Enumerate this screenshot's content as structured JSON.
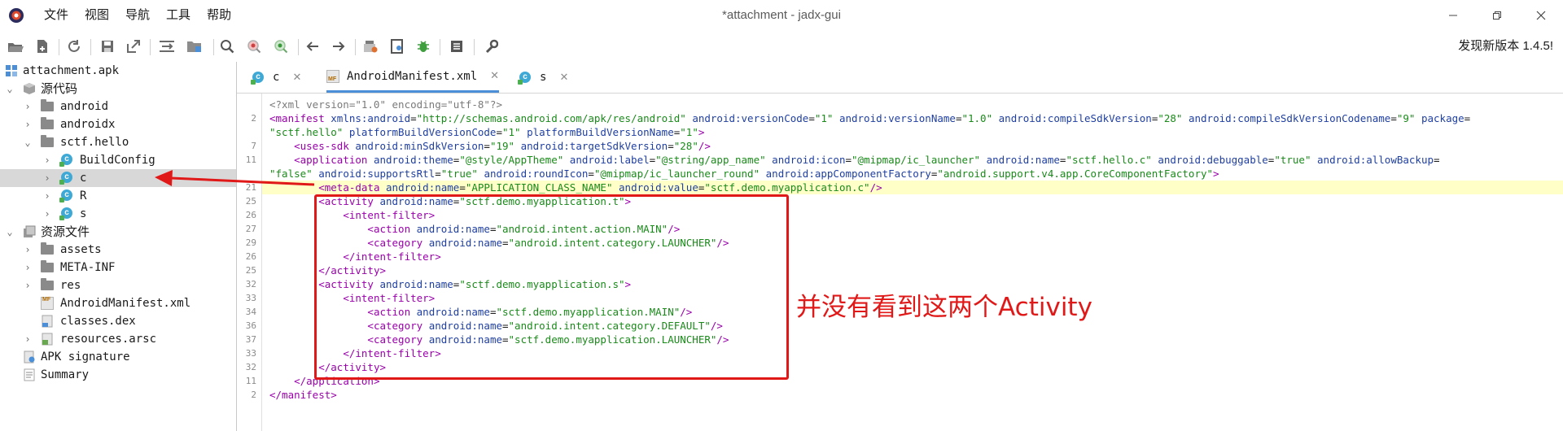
{
  "window": {
    "title": "*attachment - jadx-gui",
    "menu": [
      "文件",
      "视图",
      "导航",
      "工具",
      "帮助"
    ],
    "update_notice": "发现新版本 1.4.5!"
  },
  "toolbar": {
    "icons": [
      "open-file-icon",
      "add-file-icon",
      "reload-icon",
      "save-icon",
      "export-icon",
      "sync-tree-icon",
      "flatten-packages-icon",
      "search-icon",
      "find-class-icon",
      "find-usage-icon",
      "back-icon",
      "forward-icon",
      "deobfuscation-icon",
      "decompile-icon",
      "debug-icon",
      "log-icon",
      "settings-icon"
    ]
  },
  "tree": {
    "items": [
      {
        "label": "attachment.apk",
        "icon": "apk-icon"
      },
      {
        "label": "源代码",
        "icon": "source-icon"
      },
      {
        "label": "android",
        "icon": "package-icon"
      },
      {
        "label": "androidx",
        "icon": "package-icon"
      },
      {
        "label": "sctf.hello",
        "icon": "package-icon"
      },
      {
        "label": "BuildConfig",
        "icon": "class-icon"
      },
      {
        "label": "c",
        "icon": "class-icon"
      },
      {
        "label": "R",
        "icon": "class-icon"
      },
      {
        "label": "s",
        "icon": "class-icon"
      },
      {
        "label": "资源文件",
        "icon": "resources-icon"
      },
      {
        "label": "assets",
        "icon": "folder-icon"
      },
      {
        "label": "META-INF",
        "icon": "folder-icon"
      },
      {
        "label": "res",
        "icon": "folder-icon"
      },
      {
        "label": "AndroidManifest.xml",
        "icon": "manifest-icon"
      },
      {
        "label": "classes.dex",
        "icon": "dex-icon"
      },
      {
        "label": "resources.arsc",
        "icon": "arsc-icon"
      },
      {
        "label": "APK signature",
        "icon": "signature-icon"
      },
      {
        "label": "Summary",
        "icon": "summary-icon"
      }
    ]
  },
  "tabs": [
    {
      "label": "c",
      "close": "✕"
    },
    {
      "label": "AndroidManifest.xml",
      "close": "✕"
    },
    {
      "label": "s",
      "close": "✕"
    }
  ],
  "code": {
    "line_numbers": [
      "",
      "2",
      "",
      "7",
      "11",
      "",
      "21",
      "25",
      "26",
      "27",
      "29",
      "26",
      "25",
      "32",
      "33",
      "34",
      "36",
      "37",
      "33",
      "32",
      "11",
      "2"
    ],
    "lines": [
      "<?xml version=\"1.0\" encoding=\"utf-8\"?>",
      "<manifest xmlns:android=\"http://schemas.android.com/apk/res/android\" android:versionCode=\"1\" android:versionName=\"1.0\" android:compileSdkVersion=\"28\" android:compileSdkVersionCodename=\"9\" package=",
      "\"sctf.hello\" platformBuildVersionCode=\"1\" platformBuildVersionName=\"1\">",
      "    <uses-sdk android:minSdkVersion=\"19\" android:targetSdkVersion=\"28\"/>",
      "    <application android:theme=\"@style/AppTheme\" android:label=\"@string/app_name\" android:icon=\"@mipmap/ic_launcher\" android:name=\"sctf.hello.c\" android:debuggable=\"true\" android:allowBackup=",
      "\"false\" android:supportsRtl=\"true\" android:roundIcon=\"@mipmap/ic_launcher_round\" android:appComponentFactory=\"android.support.v4.app.CoreComponentFactory\">",
      "        <meta-data android:name=\"APPLICATION_CLASS_NAME\" android:value=\"sctf.demo.myapplication.c\"/>",
      "        <activity android:name=\"sctf.demo.myapplication.t\">",
      "            <intent-filter>",
      "                <action android:name=\"android.intent.action.MAIN\"/>",
      "                <category android:name=\"android.intent.category.LAUNCHER\"/>",
      "            </intent-filter>",
      "        </activity>",
      "        <activity android:name=\"sctf.demo.myapplication.s\">",
      "            <intent-filter>",
      "                <action android:name=\"sctf.demo.myapplication.MAIN\"/>",
      "                <category android:name=\"android.intent.category.DEFAULT\"/>",
      "                <category android:name=\"sctf.demo.myapplication.LAUNCHER\"/>",
      "            </intent-filter>",
      "        </activity>",
      "    </application>",
      "</manifest>"
    ]
  },
  "annotation": {
    "text": "并没有看到这两个Activity",
    "color": "#e01818"
  },
  "colors": {
    "tag": "#9900aa",
    "attr": "#1f3fa0",
    "string": "#1a8a1a",
    "highlight_line": "#ffffc8",
    "active_tab": "#4a8fd8"
  }
}
